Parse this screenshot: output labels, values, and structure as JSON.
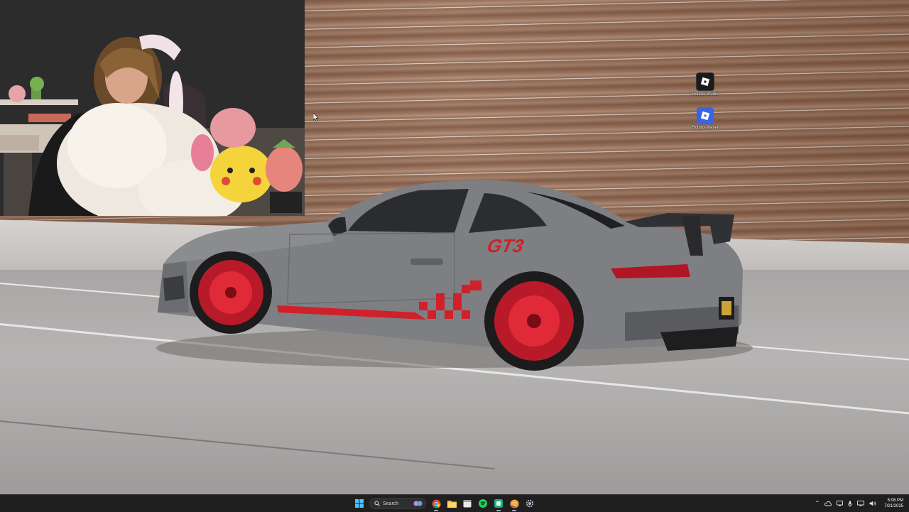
{
  "desktop": {
    "wallpaper_description_colors": {
      "wall": "#8a6550",
      "road": "#a8a6a5",
      "car_body": "#7e7f82",
      "car_accent": "#d0202a"
    },
    "car_livery_text": "GT3",
    "icons": [
      {
        "label": "Roblox Studio",
        "icon": "roblox-studio-icon"
      },
      {
        "label": "Roblox Player",
        "icon": "roblox-player-icon"
      }
    ]
  },
  "taskbar": {
    "search_placeholder": "Search",
    "pinned": [
      {
        "name": "widgets-icon"
      },
      {
        "name": "chrome-icon"
      },
      {
        "name": "file-explorer-icon"
      },
      {
        "name": "calendar-app-icon"
      },
      {
        "name": "spotify-icon"
      },
      {
        "name": "app-green-icon"
      },
      {
        "name": "chrome-canary-icon"
      },
      {
        "name": "settings-icon"
      }
    ],
    "clock": {
      "time": "5:08 PM",
      "date": "7/21/2025"
    }
  }
}
